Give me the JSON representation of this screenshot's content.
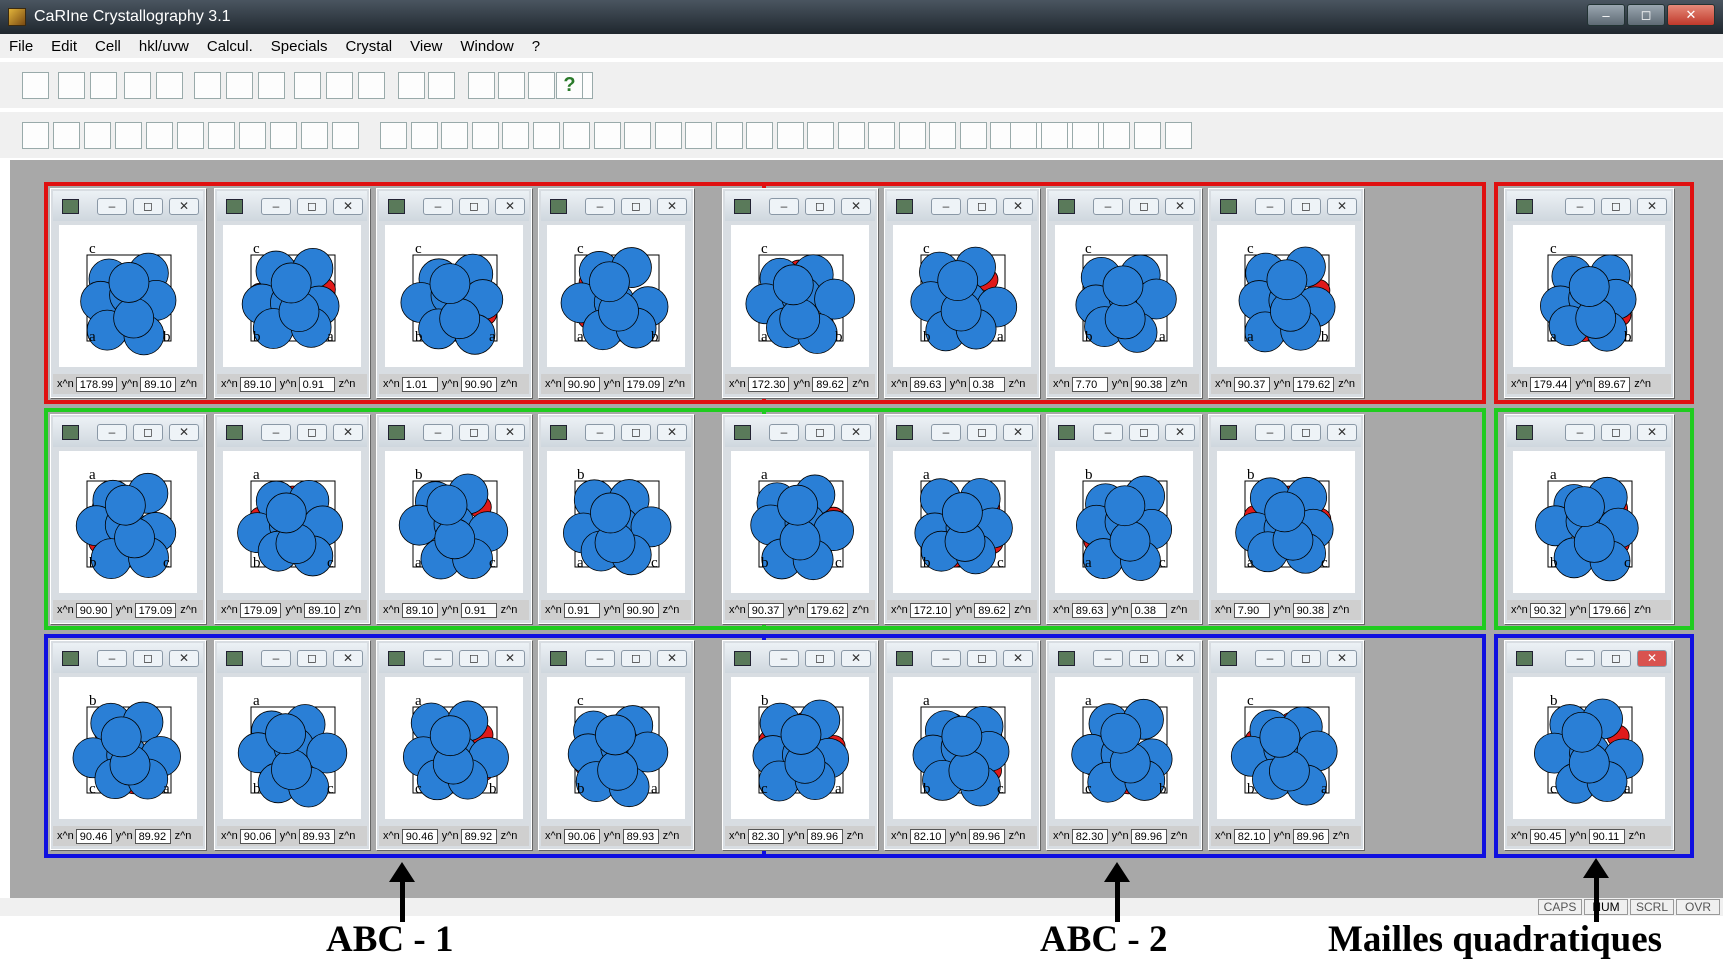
{
  "window": {
    "title": "CaRIne Crystallography 3.1",
    "min_label": "–",
    "max_label": "◻",
    "close_label": "✕"
  },
  "menu": [
    "File",
    "Edit",
    "Cell",
    "hkl/uvw",
    "Calcul.",
    "Specials",
    "Crystal",
    "View",
    "Window",
    "?"
  ],
  "help_label": "?",
  "status_keys": [
    "CAPS",
    "NUM",
    "SCRL",
    "OVR"
  ],
  "captions": {
    "abc1": "ABC - 1",
    "abc2": "ABC - 2",
    "quad": "Mailles  quadratiques"
  },
  "colors": {
    "row1": "#e01010",
    "row2": "#20cc20",
    "row3": "#1010e0",
    "atom": "#2a7fd6",
    "atom_small": "#e01a1a",
    "axis_label": "#1a1ad0"
  },
  "status_labels": {
    "x": "x^n",
    "y": "y^n",
    "z": "z^n"
  },
  "panels": [
    {
      "axes": [
        "c",
        "a",
        "b"
      ],
      "x": "178.99",
      "y": "89.10"
    },
    {
      "axes": [
        "c",
        "b",
        "a"
      ],
      "x": "89.10",
      "y": "0.91"
    },
    {
      "axes": [
        "c",
        "b",
        "a"
      ],
      "x": "1.01",
      "y": "90.90"
    },
    {
      "axes": [
        "c",
        "a",
        "b"
      ],
      "x": "90.90",
      "y": "179.09"
    },
    {
      "axes": [
        "c",
        "a",
        "b"
      ],
      "x": "172.30",
      "y": "89.62"
    },
    {
      "axes": [
        "c",
        "b",
        "a"
      ],
      "x": "89.63",
      "y": "0.38"
    },
    {
      "axes": [
        "c",
        "b",
        "a"
      ],
      "x": "7.70",
      "y": "90.38"
    },
    {
      "axes": [
        "c",
        "a",
        "b"
      ],
      "x": "90.37",
      "y": "179.62"
    },
    {
      "axes": [
        "c",
        "a",
        "b"
      ],
      "x": "179.44",
      "y": "89.67"
    },
    {
      "axes": [
        "a",
        "b",
        "c"
      ],
      "x": "90.90",
      "y": "179.09"
    },
    {
      "axes": [
        "a",
        "b",
        "c"
      ],
      "x": "179.09",
      "y": "89.10"
    },
    {
      "axes": [
        "b",
        "a",
        "c"
      ],
      "x": "89.10",
      "y": "0.91"
    },
    {
      "axes": [
        "b",
        "a",
        "c"
      ],
      "x": "0.91",
      "y": "90.90"
    },
    {
      "axes": [
        "a",
        "b",
        "c"
      ],
      "x": "90.37",
      "y": "179.62"
    },
    {
      "axes": [
        "a",
        "b",
        "c"
      ],
      "x": "172.10",
      "y": "89.62"
    },
    {
      "axes": [
        "b",
        "a",
        "c"
      ],
      "x": "89.63",
      "y": "0.38"
    },
    {
      "axes": [
        "b",
        "a",
        "c"
      ],
      "x": "7.90",
      "y": "90.38"
    },
    {
      "axes": [
        "a",
        "b",
        "c"
      ],
      "x": "90.32",
      "y": "179.66"
    },
    {
      "axes": [
        "b",
        "c",
        "a"
      ],
      "x": "90.46",
      "y": "89.92"
    },
    {
      "axes": [
        "a",
        "b",
        "c"
      ],
      "x": "90.06",
      "y": "89.93"
    },
    {
      "axes": [
        "a",
        "c",
        "b"
      ],
      "x": "90.46",
      "y": "89.92"
    },
    {
      "axes": [
        "c",
        "b",
        "a"
      ],
      "x": "90.06",
      "y": "89.93"
    },
    {
      "axes": [
        "b",
        "c",
        "a"
      ],
      "x": "82.30",
      "y": "89.96"
    },
    {
      "axes": [
        "a",
        "b",
        "c"
      ],
      "x": "82.10",
      "y": "89.96"
    },
    {
      "axes": [
        "a",
        "c",
        "b"
      ],
      "x": "82.30",
      "y": "89.96"
    },
    {
      "axes": [
        "c",
        "b",
        "a"
      ],
      "x": "82.10",
      "y": "89.96"
    },
    {
      "axes": [
        "b",
        "c",
        "a"
      ],
      "x": "90.45",
      "y": "90.11"
    }
  ]
}
